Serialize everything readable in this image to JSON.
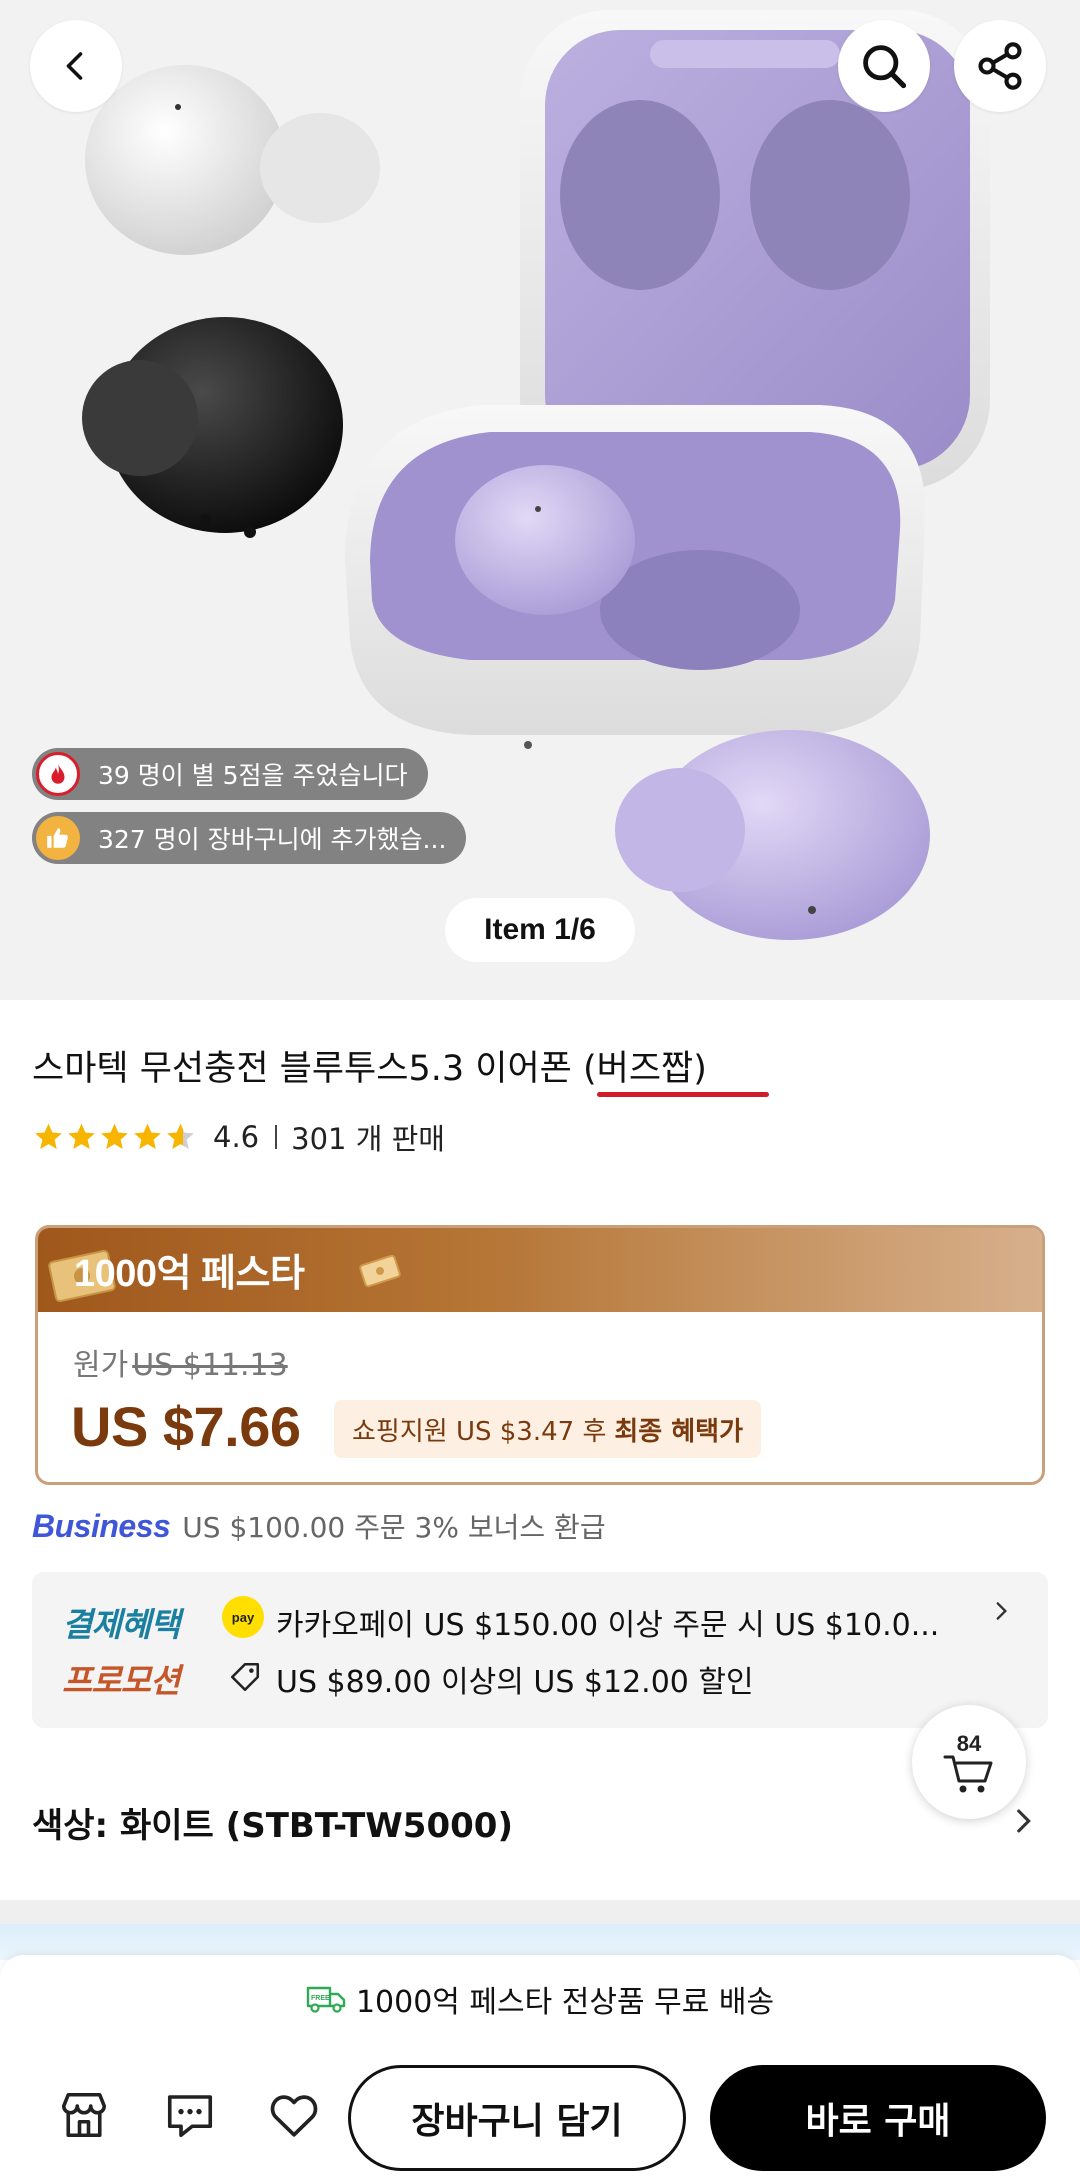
{
  "hero": {
    "item_counter": "Item 1/6",
    "social_proof": [
      {
        "icon": "fire-icon",
        "text": "39 명이 별 5점을 주었습니다"
      },
      {
        "icon": "thumbs-up-icon",
        "text": "327 명이 장바구니에 추가했습..."
      }
    ]
  },
  "product": {
    "title": "스마텍 무선충전 블루투스5.3 이어폰 (버즈짭)",
    "rating": 4.6,
    "rating_text": "4.6",
    "sold_text": "301 개 판매"
  },
  "price": {
    "festa_title": "1000억 페스타",
    "original_label": "원가",
    "original_price": "US $11.13",
    "current_price": "US $7.66",
    "benefit_prefix": "쇼핑지원 US $3.47 후",
    "benefit_bold": "최종 혜택가"
  },
  "business": {
    "logo": "Business",
    "text": "US $100.00 주문 3% 보너스 환급"
  },
  "promotions": {
    "payment_label": "결제혜택",
    "payment_badge": "pay",
    "payment_text": "카카오페이 US $150.00 이상 주문 시 US $10.0...",
    "promo_label": "프로모션",
    "promo_text": "US $89.00 이상의 US $12.00 할인"
  },
  "cart_float": {
    "count": "84"
  },
  "options": {
    "color_label": "색상: 화이트 (STBT-TW5000)"
  },
  "bottom_bar": {
    "shipping_text": "1000억 페스타 전상품 무료 배송",
    "add_to_cart": "장바구니 담기",
    "buy_now": "바로 구매"
  },
  "colors": {
    "accent_brown": "#7a3a0d",
    "underline_red": "#d11a2a",
    "star_yellow": "#f7b500",
    "business_blue": "#3f56d8"
  }
}
